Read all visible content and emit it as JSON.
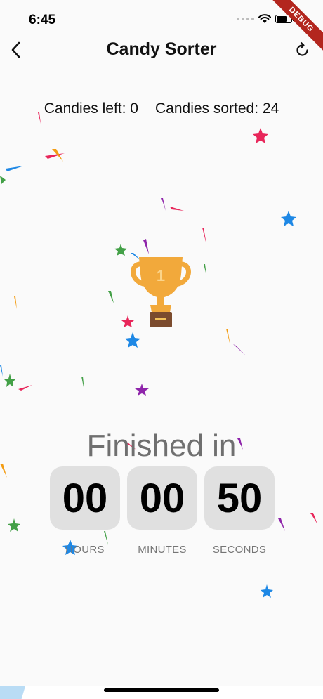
{
  "status_bar": {
    "time": "6:45"
  },
  "debug_banner": {
    "label": "DEBUG"
  },
  "app_bar": {
    "title": "Candy Sorter",
    "back_icon": "chevron-left-icon",
    "reset_icon": "refresh-icon"
  },
  "counters": {
    "left_text": "Candies left: 0",
    "sorted_text": "Candies sorted: 24"
  },
  "trophy": {
    "icon": "trophy-icon",
    "rank": "1"
  },
  "finished": {
    "title": "Finished in",
    "hours": {
      "value": "00",
      "label": "HOURS"
    },
    "minutes": {
      "value": "00",
      "label": "MINUTES"
    },
    "seconds": {
      "value": "50",
      "label": "SECONDS"
    }
  },
  "colors": {
    "background": "#fafafa",
    "timer_box": "#e0e0e0",
    "trophy_gold": "#f2a93b",
    "trophy_base": "#7b4b2e",
    "debug_red": "#b3261e",
    "confetti_red": "#e8265a",
    "confetti_blue": "#1e88e5",
    "confetti_green": "#43a047",
    "confetti_purple": "#8e24aa",
    "confetti_orange": "#f39c12"
  }
}
